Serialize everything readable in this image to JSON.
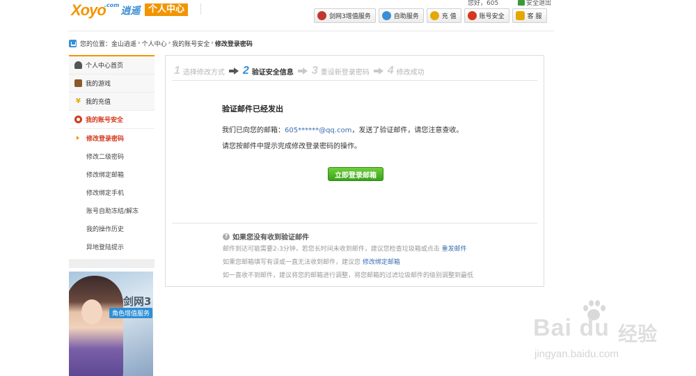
{
  "header": {
    "logo_text": "Xoyo",
    "logo_com": ".com",
    "logo_cn": "逍遥",
    "logo_badge": "个人中心",
    "welcome": "您好，605",
    "logout": "安全退出",
    "nav": [
      {
        "label": "剑网3增值服务",
        "icon": "sword-icon",
        "color": "#c0392b"
      },
      {
        "label": "自助服务",
        "icon": "user-icon",
        "color": "#3a8fd6"
      },
      {
        "label": "充 值",
        "icon": "coin-icon",
        "color": "#e6a800"
      },
      {
        "label": "账号安全",
        "icon": "shield-icon",
        "color": "#d4381c"
      },
      {
        "label": "客 服",
        "icon": "handshake-icon",
        "color": "#e6a800"
      }
    ]
  },
  "breadcrumb": {
    "label": "您的位置：",
    "items": [
      "金山逍遥",
      "个人中心",
      "我的账号安全"
    ],
    "separator": "›",
    "current": "修改登录密码"
  },
  "sidebar": {
    "top_items": [
      {
        "label": "个人中心首页",
        "icon": "person-icon",
        "color": "#444"
      },
      {
        "label": "我的游戏",
        "icon": "game-icon",
        "color": "#8a5a2a"
      },
      {
        "label": "我的充值",
        "icon": "yuan-icon",
        "color": "#e6a800"
      }
    ],
    "security": {
      "label": "我的账号安全",
      "icon": "lifebuoy-icon",
      "color": "#d4381c"
    },
    "sub_items": [
      "修改登录密码",
      "修改二级密码",
      "修改绑定邮箱",
      "修改绑定手机",
      "账号自助冻结/解冻",
      "我的操作历史",
      "异地登陆提示"
    ],
    "active_sub": 0
  },
  "promo": {
    "title": "剑网3",
    "tag": "角色增值服务"
  },
  "steps": [
    {
      "num": "1",
      "text": "选择修改方式"
    },
    {
      "num": "2",
      "text": "验证安全信息"
    },
    {
      "num": "3",
      "text": "重设新登录密码"
    },
    {
      "num": "4",
      "text": "修改成功"
    }
  ],
  "message": {
    "title": "验证邮件已经发出",
    "line1_prefix": "我们已向您的邮箱：",
    "email": "605******@qq.com",
    "line1_suffix": "，发送了验证邮件，请您注意查收。",
    "line2": "请您按邮件中提示完成修改登录密码的操作。",
    "button": "立即登录邮箱"
  },
  "help": {
    "title": "如果您没有收到验证邮件",
    "row1_text": "邮件到达可能需要2-3分钟，若您长时间未收到邮件，建议您检查垃圾箱或点击",
    "row1_link": "重发邮件",
    "row2_text": "如果您邮箱填写有误或一直无法收到邮件，建议您",
    "row2_link": "修改绑定邮箱",
    "row3_text": "如一直收不到邮件，建议将您的邮箱进行调整，将您邮箱的过滤垃圾邮件的级别调整到最低"
  },
  "watermark": {
    "brand": "Bai  du",
    "cn": "经验",
    "url": "jingyan.baidu.com"
  }
}
